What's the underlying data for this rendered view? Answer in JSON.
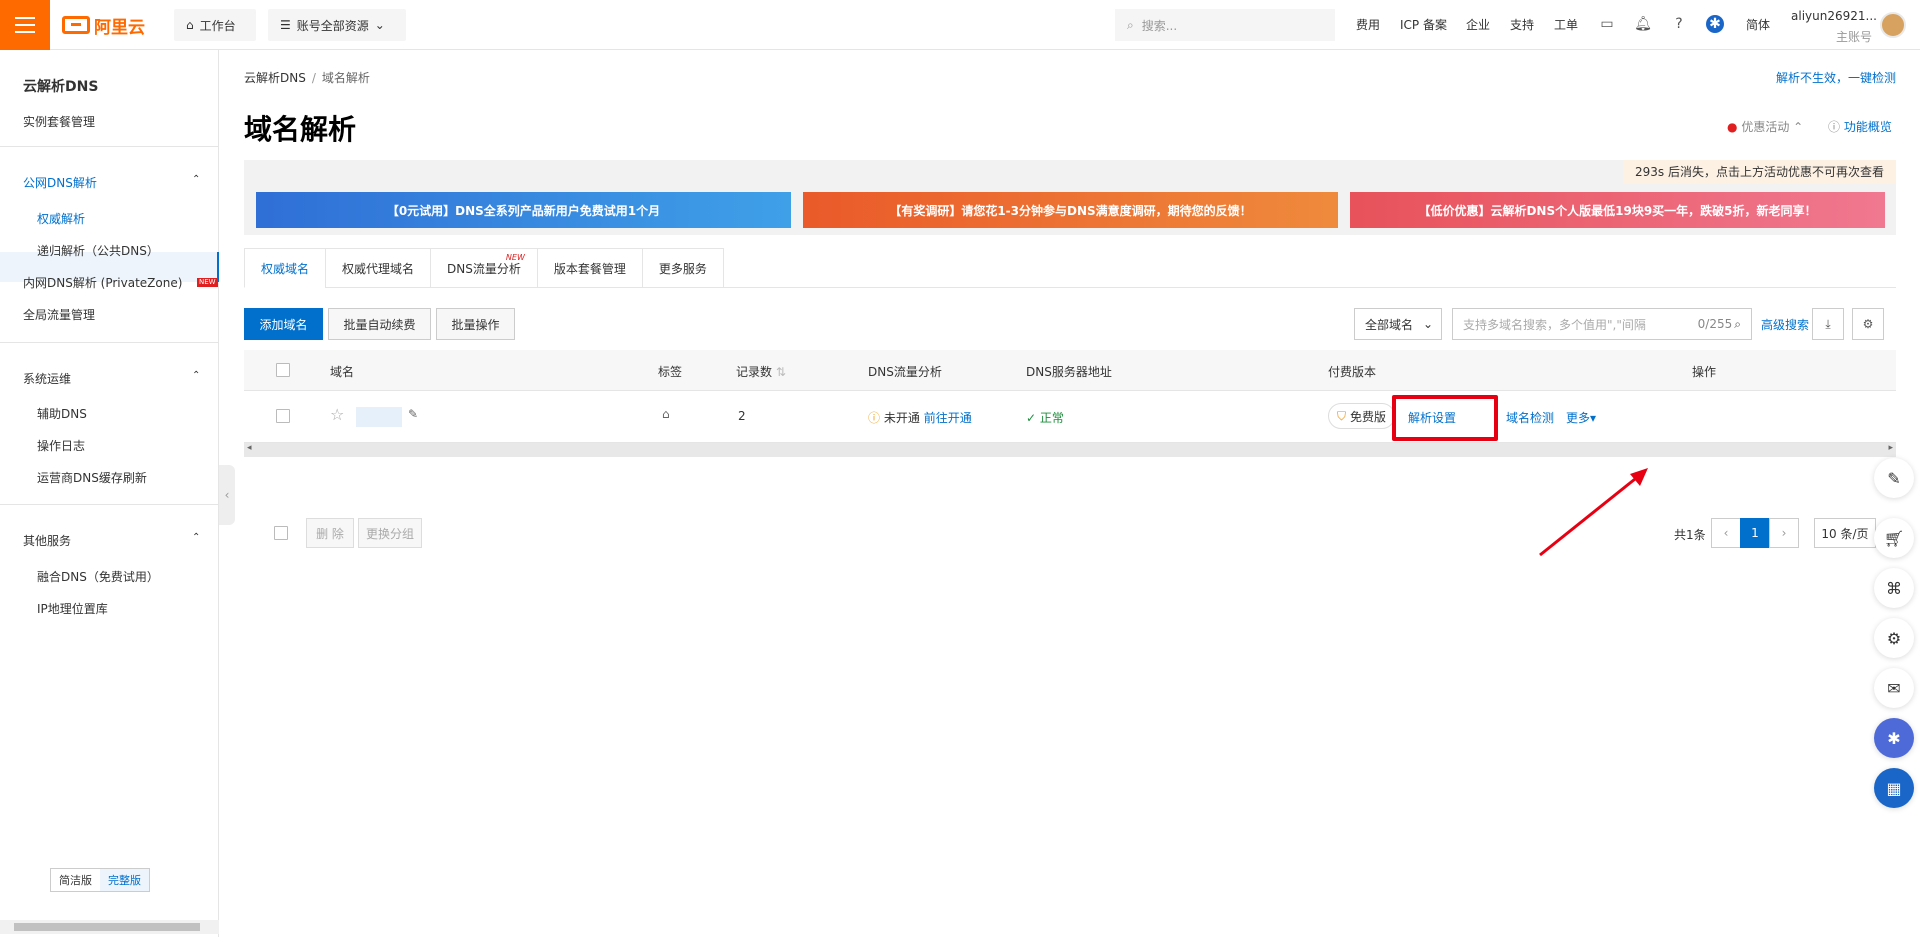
{
  "topbar": {
    "logo_text": "阿里云",
    "workbench_label": "工作台",
    "resource_label": "账号全部资源",
    "search_placeholder": "搜索...",
    "nav": [
      "费用",
      "ICP 备案",
      "企业",
      "支持",
      "工单"
    ],
    "lang_label": "简体",
    "username": "aliyun26921...",
    "account_type": "主账号"
  },
  "sidebar": {
    "title": "云解析DNS",
    "item_instance": "实例套餐管理",
    "group_public": "公网DNS解析",
    "sub_authority": "权威解析",
    "sub_recursive": "递归解析（公共DNS）",
    "item_private": "内网DNS解析 (PrivateZone)",
    "new_badge": "NEW",
    "item_traffic": "全局流量管理",
    "group_ops": "系统运维",
    "sub_aux": "辅助DNS",
    "sub_log": "操作日志",
    "sub_cache": "运营商DNS缓存刷新",
    "group_other": "其他服务",
    "sub_fusion": "融合DNS（免费试用）",
    "sub_ip": "IP地理位置库",
    "ver_simple": "简洁版",
    "ver_full": "完整版"
  },
  "main": {
    "breadcrumb_root": "云解析DNS",
    "breadcrumb_current": "域名解析",
    "check_link": "解析不生效，一键检测",
    "page_title": "域名解析",
    "promo_label": "优惠活动",
    "overview_label": "功能概览",
    "countdown": "293s 后消失，点击上方活动优惠不可再次查看",
    "banners": [
      "【0元试用】DNS全系列产品新用户免费试用1个月",
      "【有奖调研】请您花1-3分钟参与DNS满意度调研，期待您的反馈！",
      "【低价优惠】云解析DNS个人版最低19块9买一年，跌破5折，新老同享！"
    ],
    "tabs": [
      "权威域名",
      "权威代理域名",
      "DNS流量分析",
      "版本套餐管理",
      "更多服务"
    ],
    "tab_new": "NEW",
    "btn_add": "添加域名",
    "btn_renew": "批量自动续费",
    "btn_batch": "批量操作",
    "filter_select": "全部域名",
    "search_placeholder": "支持多域名搜索，多个值用\",\"间隔",
    "search_count": "0/255",
    "adv_search": "高级搜索",
    "table": {
      "headers": [
        "域名",
        "标签",
        "记录数",
        "DNS流量分析",
        "DNS服务器地址",
        "付费版本",
        "操作"
      ],
      "row": {
        "records": "2",
        "traffic_status": "未开通",
        "traffic_link": "前往开通",
        "dns_status": "正常",
        "edition": "免费版",
        "op_settings": "解析设置",
        "op_check": "域名检测",
        "op_more": "更多"
      }
    },
    "btn_delete": "删 除",
    "btn_group": "更换分组",
    "total": "共1条",
    "current_page": "1",
    "page_size": "10 条/页"
  },
  "colors": {
    "brand": "#ff6a00",
    "link": "#0070cc",
    "highlight": "#e60012"
  }
}
